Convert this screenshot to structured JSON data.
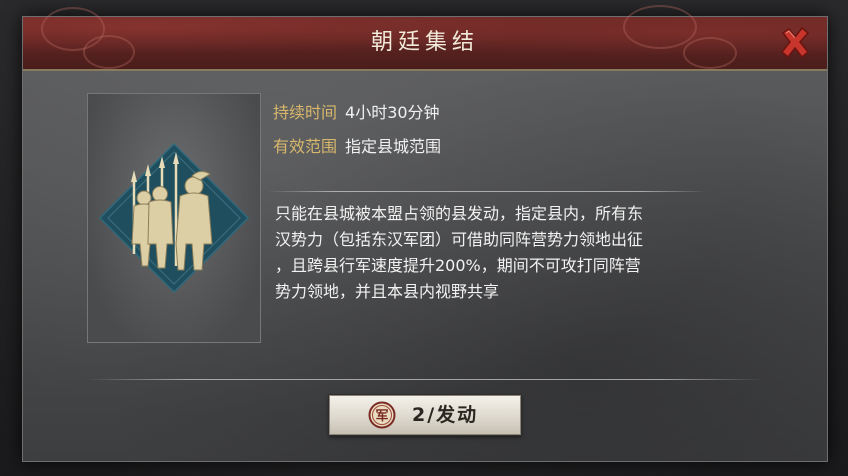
{
  "dialog": {
    "title": "朝廷集结",
    "close_icon": "close-x-icon"
  },
  "portrait": {
    "icon": "spearmen-soldiers-emblem"
  },
  "info": {
    "duration_label": "持续时间",
    "duration_value": "4小时30分钟",
    "range_label": "有效范围",
    "range_value": "指定县城范围"
  },
  "description": {
    "line1": "只能在县城被本盟占领的县发动，指定县内，所有东",
    "line2": "汉势力（包括东汉军团）可借助同阵营势力领地出征",
    "line3": "，且跨县行军速度提升200%，期间不可攻打同阵营",
    "line4": "势力领地，并且本县内视野共享"
  },
  "action": {
    "emblem_char": "军",
    "label": "2/发动"
  },
  "colors": {
    "label_gold": "#d8b76c",
    "title_red": "#6e2a27",
    "close_red": "#c0392b",
    "diamond_teal": "#1f4e5e"
  }
}
